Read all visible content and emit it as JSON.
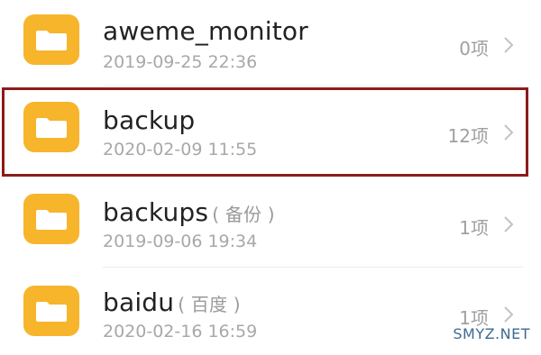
{
  "files": [
    {
      "name": "aweme_monitor",
      "alias": "",
      "date": "2019-09-25 22:36",
      "count": "0项"
    },
    {
      "name": "backup",
      "alias": "",
      "date": "2020-02-09 11:55",
      "count": "12项"
    },
    {
      "name": "backups",
      "alias": "( 备份 )",
      "date": "2019-09-06 19:34",
      "count": "1项"
    },
    {
      "name": "baidu",
      "alias": "( 百度 )",
      "date": "2020-02-16 16:59",
      "count": "1项"
    }
  ],
  "icons": {
    "folder": "folder-icon",
    "chevron": "chevron-right-icon"
  },
  "colors": {
    "folder_body": "#f7b52c",
    "folder_tab": "#f0a418",
    "highlight": "#8b1c1c",
    "watermark": "#3d6b8f"
  },
  "highlight": {
    "row_index": 1
  },
  "watermark": {
    "text": "SMYZ.NET"
  }
}
